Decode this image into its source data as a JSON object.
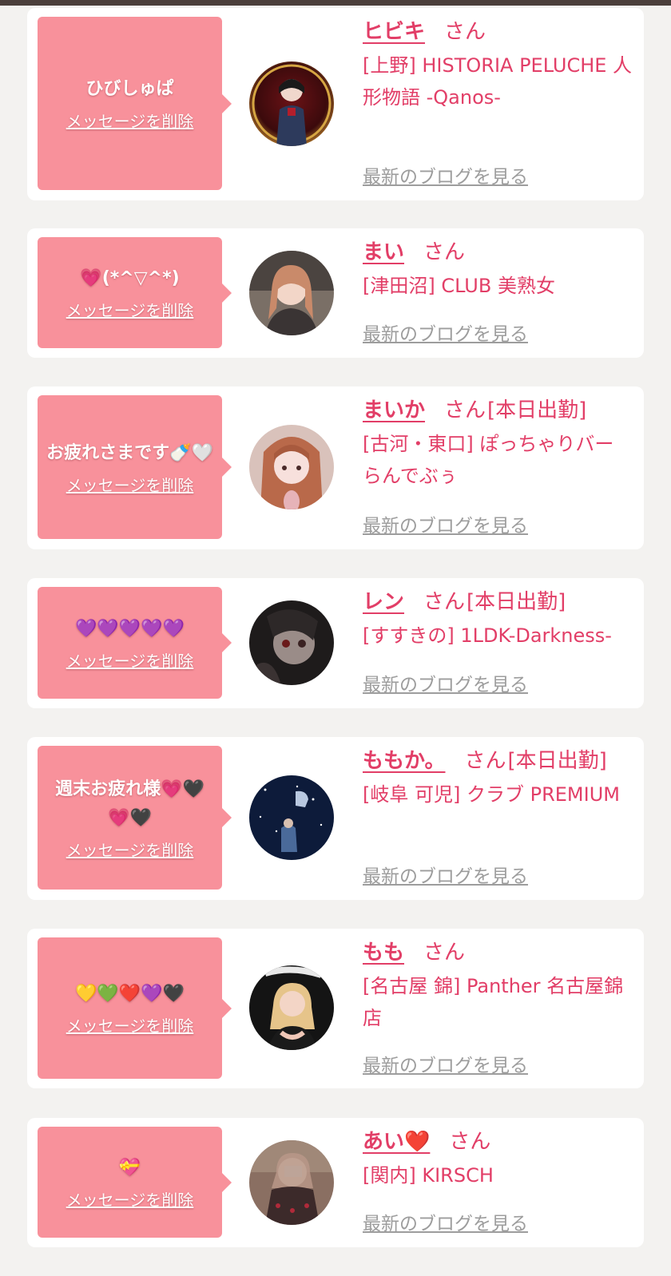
{
  "common": {
    "delete_label": "メッセージを削除",
    "san_label": "さん",
    "blog_label": "最新のブログを見る"
  },
  "colors": {
    "bubble": "#f8919b",
    "accent": "#e23e67",
    "link_gray": "#9d9d9d",
    "page_bg": "#f3f2f0"
  },
  "entries": [
    {
      "message": "ひびしゅぱ",
      "name": "ヒビキ",
      "status": "",
      "shop": "[上野] HISTORIA PELUCHE 人形物語 -Qanos-"
    },
    {
      "message": "💗(*^▽^*)",
      "name": "まい",
      "status": "",
      "shop": "[津田沼] CLUB 美熟女"
    },
    {
      "message": "お疲れさまです🍼🤍",
      "name": "まいか",
      "status": "[本日出勤]",
      "shop": "[古河・東口] ぽっちゃりバー らんでぶぅ"
    },
    {
      "message": "💜💜💜💜💜",
      "name": "レン",
      "status": "[本日出勤]",
      "shop": "[すすきの] 1LDK-Darkness-"
    },
    {
      "message": "週末お疲れ様💗🖤💗🖤",
      "name": "ももか。",
      "status": "[本日出勤]",
      "shop": "[岐阜 可児] クラブ PREMIUM"
    },
    {
      "message": "💛💚❤️💜🖤",
      "name": "もも",
      "status": "",
      "shop": "[名古屋 錦] Panther 名古屋錦店"
    },
    {
      "message": "💝",
      "name": "あい❤️",
      "status": "",
      "shop": "[関内] KIRSCH"
    }
  ]
}
